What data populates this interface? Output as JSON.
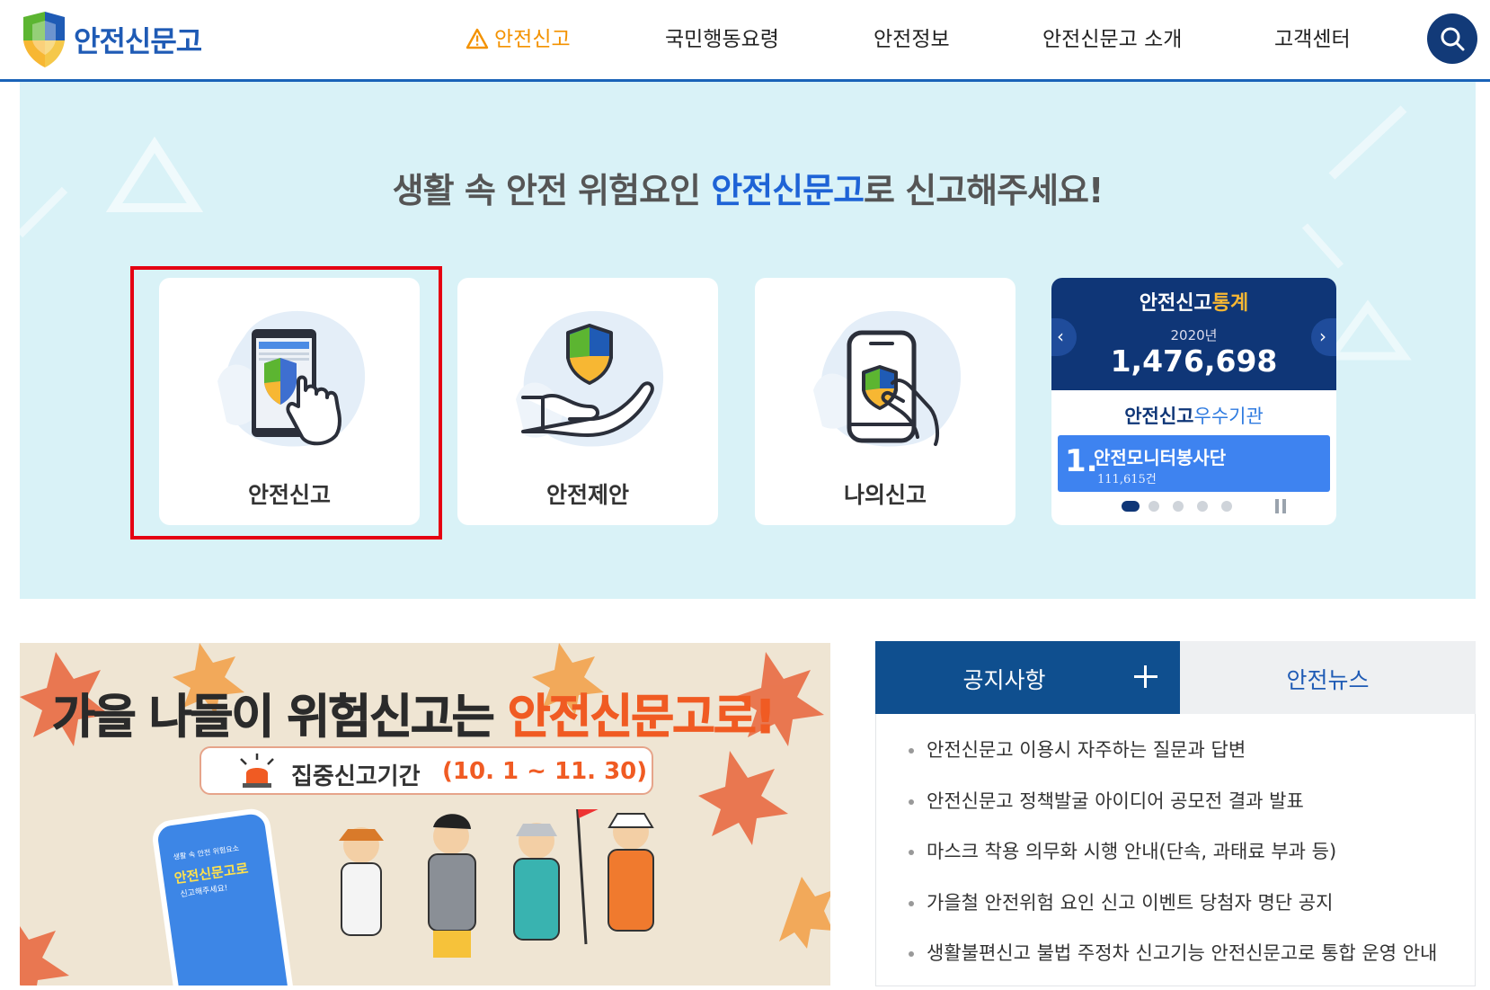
{
  "header": {
    "logo_text": "안전신문고",
    "nav": [
      {
        "label": "안전신고",
        "active": true
      },
      {
        "label": "국민행동요령",
        "active": false
      },
      {
        "label": "안전정보",
        "active": false
      },
      {
        "label": "안전신문고 소개",
        "active": false
      },
      {
        "label": "고객센터",
        "active": false
      }
    ],
    "search_icon": "search-icon"
  },
  "hero": {
    "title_prefix": "생활 속 안전 위험요인 ",
    "title_highlight": "안전신문고",
    "title_suffix": "로 신고해주세요!",
    "cards": [
      {
        "label": "안전신고",
        "icon": "phone-touch-icon"
      },
      {
        "label": "안전제안",
        "icon": "hand-shield-icon"
      },
      {
        "label": "나의신고",
        "icon": "my-report-icon"
      }
    ],
    "stats": {
      "title_main": "안전신고",
      "title_accent": "통계",
      "year": "2020년",
      "count": "1,476,698",
      "org_title_main": "안전신고",
      "org_title_accent": "우수기관",
      "org_rank": "1.",
      "org_name": "안전모니터봉사단",
      "org_count": "111,615건",
      "prev_icon": "‹",
      "next_icon": "›",
      "slide_count": 5,
      "active_slide": 1
    }
  },
  "banner": {
    "title_main": "가을 나들이 위험신고는 ",
    "title_accent": "안전신문고로!",
    "period_label": "집중신고기간",
    "period_dates": "(10. 1 ~ 11. 30)",
    "phone_small": "생활 속 안전 위험요소",
    "phone_title": "안전신문고로",
    "phone_sub": "신고해주세요!"
  },
  "notice": {
    "tab_notice": "공지사항",
    "tab_news": "안전뉴스",
    "items": [
      "안전신문고 이용시 자주하는 질문과 답변",
      "안전신문고 정책발굴 아이디어 공모전 결과 발표",
      "마스크 착용 의무화 시행 안내(단속, 과태료 부과 등)",
      "가을철 안전위험 요인 신고 이벤트 당첨자 명단 공지",
      "생활불편신고 불법 주정차 신고기능 안전신문고로 통합 운영 안내"
    ]
  },
  "colors": {
    "brand_blue": "#1f5bb5",
    "nav_active": "#f39200",
    "stats_navy": "#0f3677",
    "hero_bg": "#d9f2f7",
    "highlight_red": "#e50012"
  }
}
